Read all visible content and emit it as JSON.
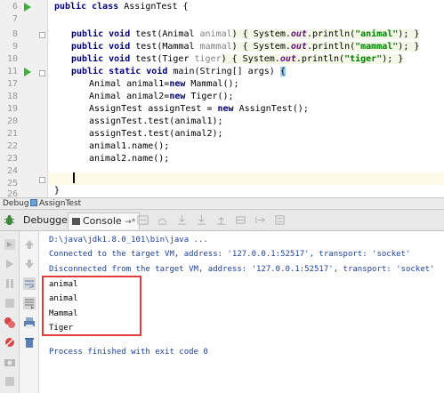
{
  "editor": {
    "lines": [
      {
        "num": "6",
        "y": 0
      },
      {
        "num": "7",
        "y": 0
      },
      {
        "num": "8",
        "y": 0
      },
      {
        "num": "9",
        "y": 0
      },
      {
        "num": "10",
        "y": 0
      },
      {
        "num": "11",
        "y": 0
      },
      {
        "num": "17",
        "y": 0
      },
      {
        "num": "18",
        "y": 0
      },
      {
        "num": "19",
        "y": 0
      },
      {
        "num": "20",
        "y": 0
      },
      {
        "num": "21",
        "y": 0
      },
      {
        "num": "22",
        "y": 0
      },
      {
        "num": "23",
        "y": 0
      },
      {
        "num": "24",
        "y": 0
      },
      {
        "num": "25",
        "y": 0
      },
      {
        "num": "26",
        "y": 0
      }
    ],
    "code": {
      "l6_kw": "public class",
      "l6_rest": " AssignTest {",
      "l8_kw": "public void",
      "l8_a": " test(Animal ",
      "l8_param": "animal",
      "l8_b": ") { System.",
      "l8_fld": "out",
      "l8_c": ".println(",
      "l8_str": "\"animal\"",
      "l8_d": "); }",
      "l9_kw": "public void",
      "l9_a": " test(Mammal ",
      "l9_param": "mammal",
      "l9_b": ") { System.",
      "l9_fld": "out",
      "l9_c": ".println(",
      "l9_str": "\"mammal\"",
      "l9_d": "); }",
      "l10_kw": "public void",
      "l10_a": " test(Tiger ",
      "l10_param": "tiger",
      "l10_b": ") { System.",
      "l10_fld": "out",
      "l10_c": ".println(",
      "l10_str": "\"tiger\"",
      "l10_d": "); }",
      "l17_kw": "public static void",
      "l17_a": " main(String[] args) ",
      "l17_brace": "{",
      "l18_a": "Animal animal1=",
      "l18_kw": "new",
      "l18_b": " Mammal();",
      "l19_a": "Animal animal2=",
      "l19_kw": "new",
      "l19_b": " Tiger();",
      "l20_a": "AssignTest assignTest = ",
      "l20_kw": "new",
      "l20_b": " AssignTest();",
      "l21": "assignTest.test(animal1);",
      "l22": "assignTest.test(animal2);",
      "l23": "animal1.name();",
      "l24": "animal2.name();",
      "l26": "}"
    }
  },
  "debugbar": {
    "label": "Debug",
    "config": "AssignTest"
  },
  "toolwindow": {
    "tab_debugger": "Debugger",
    "tab_console": "Console",
    "tab_console_suffix": "→*"
  },
  "console": {
    "cmd": "D:\\java\\jdk1.8.0_101\\bin\\java ...",
    "connected": "Connected to the target VM, address: '127.0.0.1:52517', transport: 'socket'",
    "disconnected": "Disconnected from the target VM, address: '127.0.0.1:52517', transport: 'socket'",
    "output": [
      "animal",
      "animal",
      "Mammal",
      "Tiger"
    ],
    "finished": "Process finished with exit code 0"
  },
  "colors": {
    "run_green": "#3bb33b",
    "keyword": "#000080",
    "string": "#008000",
    "console_blue": "#1a3fa0",
    "highlight_red": "#e43a3a"
  }
}
